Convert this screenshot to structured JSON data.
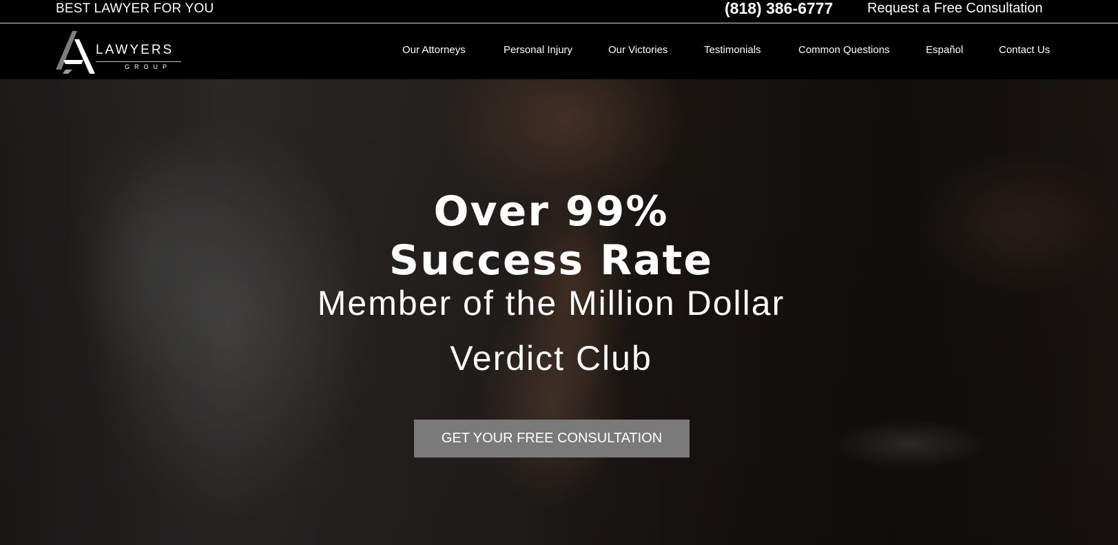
{
  "topbar": {
    "tagline": "BEST LAWYER FOR YOU",
    "phone": "(818) 386-6777",
    "consultation": "Request a Free Consultation"
  },
  "logo": {
    "name": "LAWYERS",
    "sub": "GROUP"
  },
  "nav": {
    "items": [
      {
        "label": "Our Attorneys"
      },
      {
        "label": "Personal Injury"
      },
      {
        "label": "Our Victories"
      },
      {
        "label": "Testimonials"
      },
      {
        "label": "Common Questions"
      },
      {
        "label": "Español"
      },
      {
        "label": "Contact Us"
      }
    ]
  },
  "hero": {
    "headline_line1": "Over 99%",
    "headline_line2": "Success Rate",
    "subline_line1": "Member of the Million Dollar",
    "subline_line2": "Verdict Club",
    "cta": "GET YOUR FREE CONSULTATION"
  },
  "colors": {
    "topbar_bg": "#000000",
    "cta_bg": "#7a7a7a",
    "text": "#ffffff"
  }
}
